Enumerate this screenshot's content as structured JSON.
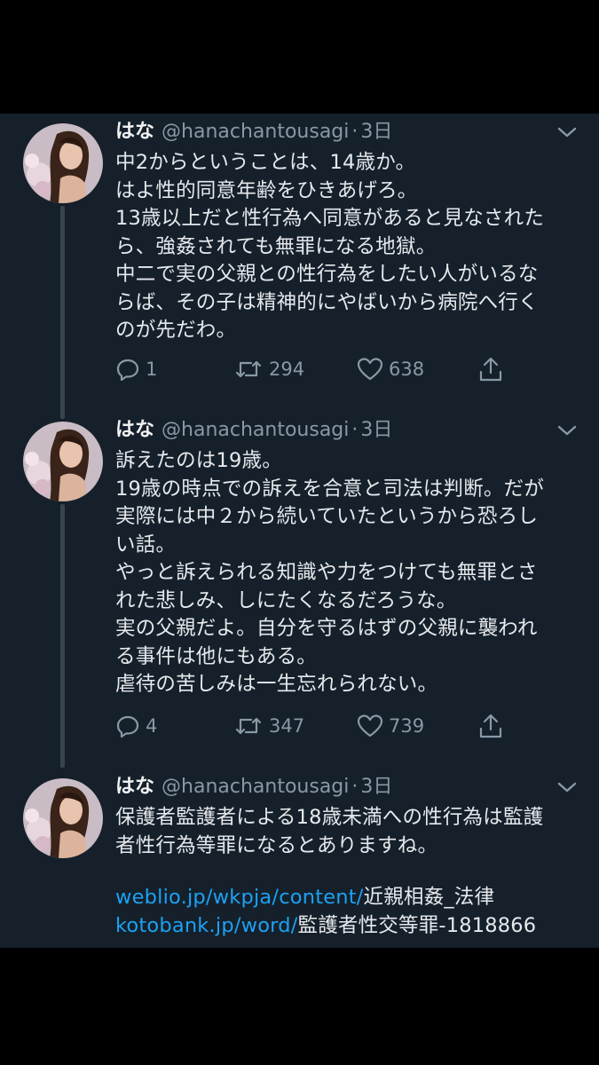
{
  "colors": {
    "background": "#15202b",
    "outer_background": "#000000",
    "text_primary": "#e6e9ec",
    "text_secondary": "#8899a6",
    "link": "#1da1f2",
    "thread_line": "#38444d"
  },
  "tweets": [
    {
      "display_name": "はな",
      "handle": "@hanachantousagi",
      "separator": "·",
      "time": "3日",
      "lines": [
        "中2からということは、14歳か。",
        "はよ性的同意年齢をひきあげろ。",
        "13歳以上だと性行為へ同意があると見なされた",
        "ら、強姦されても無罪になる地獄。",
        "中二で実の父親との性行為をしたい人がいるな",
        "らば、その子は精神的にやばいから病院へ行く",
        "のが先だわ。"
      ],
      "replies": "1",
      "retweets": "294",
      "likes": "638"
    },
    {
      "display_name": "はな",
      "handle": "@hanachantousagi",
      "separator": "·",
      "time": "3日",
      "lines": [
        "訴えたのは19歳。",
        "19歳の時点での訴えを合意と司法は判断。だが",
        "実際には中２から続いていたというから恐ろし",
        "い話。",
        "やっと訴えられる知識や力をつけても無罪とさ",
        "れた悲しみ、しにたくなるだろうな。",
        "実の父親だよ。自分を守るはずの父親に襲われ",
        "る事件は他にもある。",
        "虐待の苦しみは一生忘れられない。"
      ],
      "replies": "4",
      "retweets": "347",
      "likes": "739"
    },
    {
      "display_name": "はな",
      "handle": "@hanachantousagi",
      "separator": "·",
      "time": "3日",
      "lines": [
        "保護者監護者による18歳未満への性行為は監護",
        "者性行為等罪になるとありますね。"
      ],
      "links": [
        {
          "url_part": "weblio.jp/wkpja/content/",
          "text_part": "近親相姦_法律"
        },
        {
          "url_part": "kotobank.jp/word/",
          "text_part": "監護者性交等罪-1818866"
        }
      ]
    }
  ],
  "icons": {
    "reply": "reply-icon",
    "retweet": "retweet-icon",
    "like": "heart-icon",
    "share": "share-icon",
    "menu": "chevron-down-icon"
  }
}
